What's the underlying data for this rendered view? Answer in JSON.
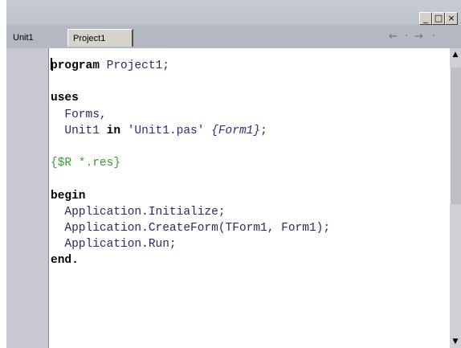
{
  "window": {
    "minimize": "_",
    "restore": "□",
    "close": "×"
  },
  "tabs": [
    {
      "label": "Unit1",
      "active": false
    },
    {
      "label": "Project1",
      "active": true
    }
  ],
  "nav": {
    "back": "←",
    "back_dropdown": "·",
    "forward": "→",
    "forward_dropdown": "·"
  },
  "code": {
    "line1_kw": "program",
    "line1_rest": " Project1;",
    "line3_kw": "uses",
    "line4": "  Forms,",
    "line5_ident": "  Unit1 ",
    "line5_kw": "in",
    "line5_str": " 'Unit1.pas'",
    "line5_cmt": " {Form1}",
    "line5_end": ";",
    "line7_dir": "{$R *.res}",
    "line9_kw": "begin",
    "line10": "  Application.Initialize;",
    "line11": "  Application.CreateForm(TForm1, Form1);",
    "line12": "  Application.Run;",
    "line13_kw": "end",
    "line13_end": "."
  },
  "colors": {
    "gutter": "#c8c8d0",
    "keyword": "#000000",
    "identifier": "#2a2a60",
    "directive": "#3a9a3a"
  }
}
